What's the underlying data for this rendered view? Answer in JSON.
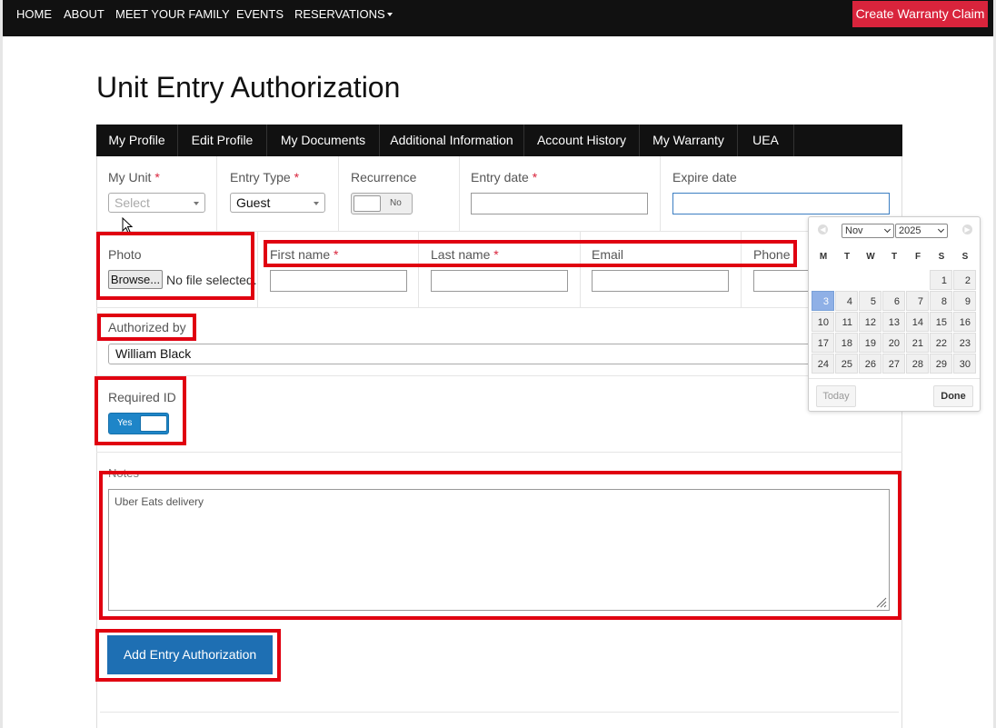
{
  "topnav": {
    "items": [
      "HOME",
      "ABOUT",
      "MEET YOUR FAMILY",
      "EVENTS",
      "RESERVATIONS"
    ],
    "warranty_button": "Create Warranty Claim"
  },
  "page_title": "Unit Entry Authorization",
  "tabs": [
    "My Profile",
    "Edit Profile",
    "My Documents",
    "Additional Information",
    "Account History",
    "My Warranty",
    "UEA"
  ],
  "form": {
    "my_unit": {
      "label": "My Unit",
      "placeholder": "Select"
    },
    "entry_type": {
      "label": "Entry Type",
      "value": "Guest"
    },
    "recurrence": {
      "label": "Recurrence",
      "state": "No"
    },
    "entry_date": {
      "label": "Entry date",
      "value": ""
    },
    "expire_date": {
      "label": "Expire date",
      "value": ""
    },
    "photo": {
      "label": "Photo",
      "button": "Browse...",
      "status": "No file selected."
    },
    "first_name": {
      "label": "First name"
    },
    "last_name": {
      "label": "Last name"
    },
    "email": {
      "label": "Email"
    },
    "phone": {
      "label": "Phone"
    },
    "authorized_by": {
      "label": "Authorized by",
      "value": "William Black"
    },
    "required_id": {
      "label": "Required ID",
      "state": "Yes"
    },
    "notes": {
      "label": "Notes",
      "value": "Uber Eats delivery"
    },
    "submit": "Add Entry Authorization",
    "required_marker": "*"
  },
  "datepicker": {
    "month": "Nov",
    "year": "2025",
    "weekdays": [
      "M",
      "T",
      "W",
      "T",
      "F",
      "S",
      "S"
    ],
    "weeks": [
      [
        "",
        "",
        "",
        "",
        "",
        "1",
        "2"
      ],
      [
        "3",
        "4",
        "5",
        "6",
        "7",
        "8",
        "9"
      ],
      [
        "10",
        "11",
        "12",
        "13",
        "14",
        "15",
        "16"
      ],
      [
        "17",
        "18",
        "19",
        "20",
        "21",
        "22",
        "23"
      ],
      [
        "24",
        "25",
        "26",
        "27",
        "28",
        "29",
        "30"
      ]
    ],
    "today": "3",
    "today_button": "Today",
    "done_button": "Done"
  },
  "colors": {
    "nav_bg": "#111111",
    "warranty_button": "#d9243c",
    "primary_button": "#1e6fb3",
    "highlight_border": "#e00010",
    "today_cell": "#8fb0e6"
  }
}
